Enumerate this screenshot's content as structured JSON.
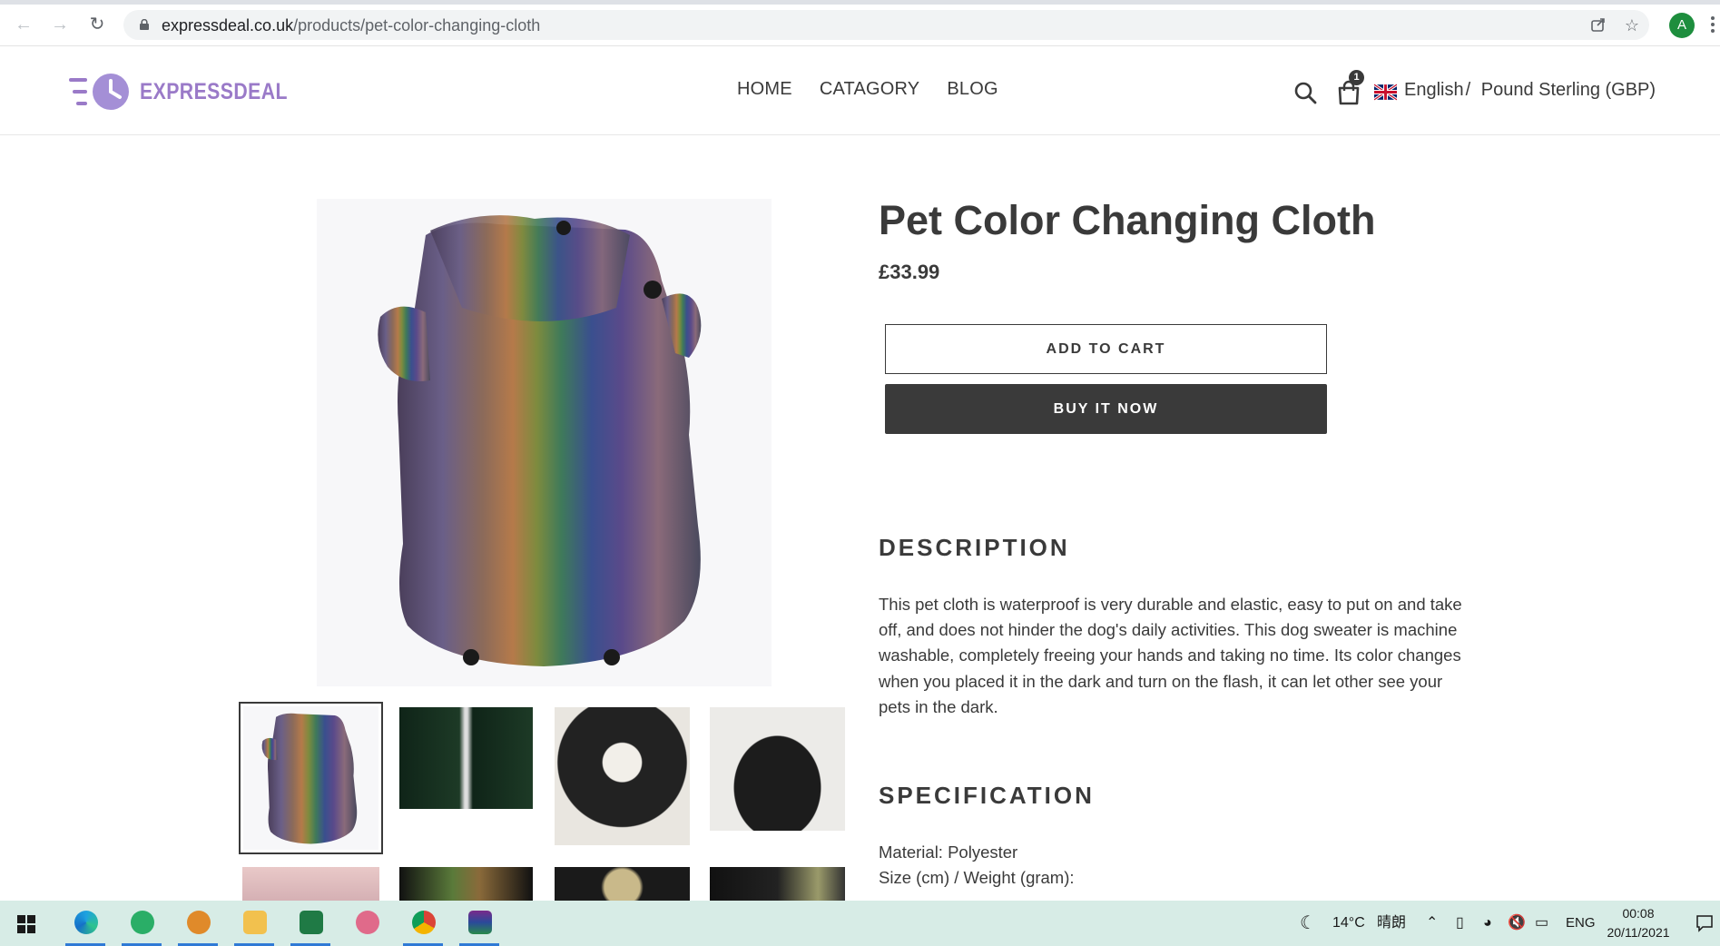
{
  "browser": {
    "url_domain": "expressdeal.co.uk",
    "url_path": "/products/pet-color-changing-cloth",
    "profile_initial": "A"
  },
  "site": {
    "logo_text": "EXPRESSDEAL",
    "nav": [
      "HOME",
      "CATAGORY",
      "BLOG"
    ],
    "cart_count": "1",
    "language": "English",
    "separator": "/",
    "currency": "Pound Sterling (GBP)"
  },
  "product": {
    "title": "Pet Color Changing Cloth",
    "price": "£33.99",
    "add_to_cart_label": "ADD TO CART",
    "buy_now_label": "BUY IT NOW",
    "description_heading": "DESCRIPTION",
    "description": "This pet cloth is waterproof is very durable and elastic, easy to put on and take off, and does not hinder the dog's daily activities. This dog sweater is machine washable, completely freeing your hands and taking no time. Its color changes when you placed it in the dark and turn on the flash, it can let other see your pets in the dark.",
    "specification_heading": "SPECIFICATION",
    "spec_material": "Material: Polyester",
    "spec_size": "Size (cm) / Weight (gram):"
  },
  "taskbar": {
    "weather_temp": "14°C",
    "weather_text": "晴朗",
    "input_lang": "ENG",
    "time": "00:08",
    "date": "20/11/2021"
  },
  "colors": {
    "text": "#3a3a3a",
    "brand": "#9a7ac8",
    "taskbar": "#d7ece6"
  }
}
